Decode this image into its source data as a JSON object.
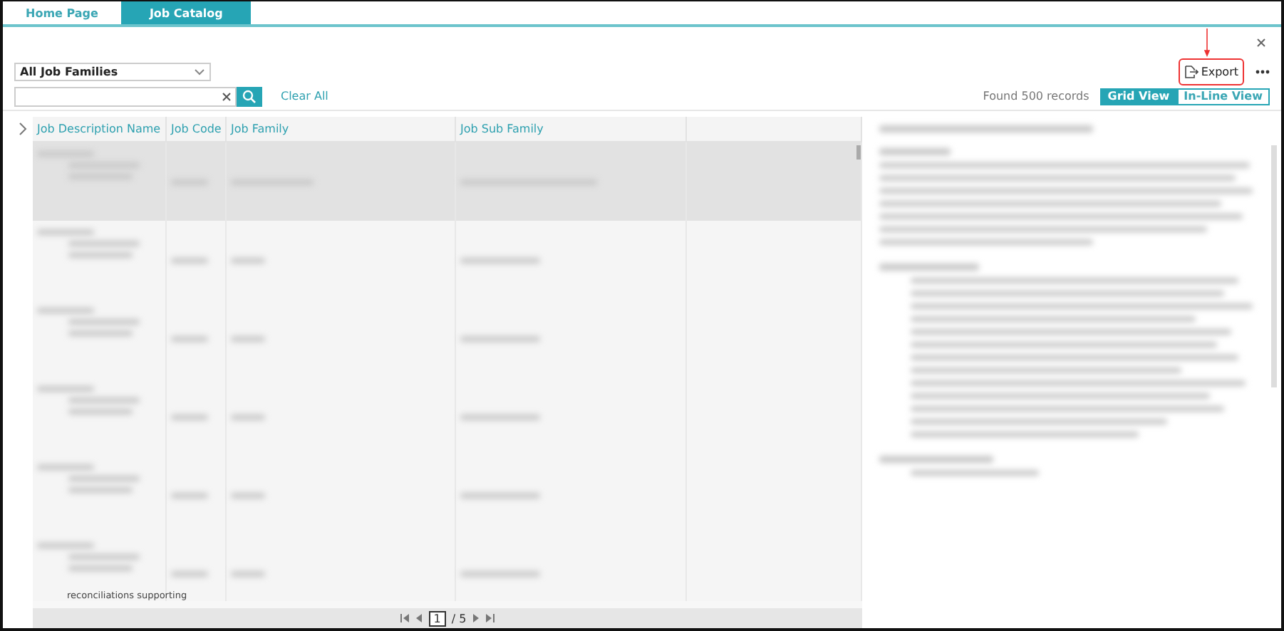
{
  "tabs": [
    {
      "label": "Home Page",
      "selected": false
    },
    {
      "label": "Job Catalog",
      "selected": true
    }
  ],
  "toolbar": {
    "export_label": "Export",
    "export_highlighted": true,
    "family_filter": "All Job Families",
    "clear_all": "Clear All",
    "records_found": "Found 500 records",
    "views": [
      {
        "label": "Grid View",
        "selected": true
      },
      {
        "label": "In-Line View",
        "selected": false
      }
    ]
  },
  "grid": {
    "columns": [
      "Job Description Name",
      "Job Code",
      "Job Family",
      "Job Sub Family"
    ],
    "rows": [
      {
        "selected": true
      },
      {
        "selected": false
      },
      {
        "selected": false
      },
      {
        "selected": false
      },
      {
        "selected": false
      },
      {
        "selected": false,
        "visible_text": "reconciliations supporting"
      }
    ],
    "pager": {
      "page": "1",
      "total": "/ 5"
    }
  }
}
